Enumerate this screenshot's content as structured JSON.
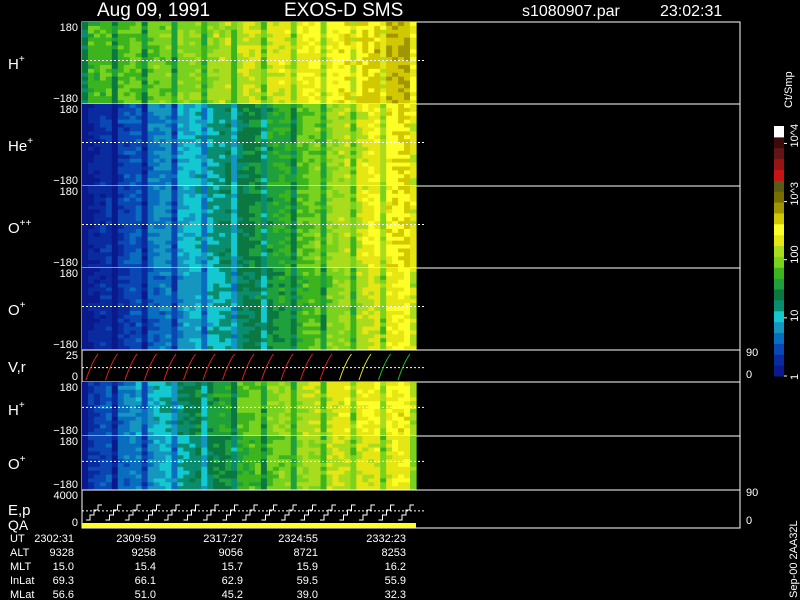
{
  "header": {
    "date": "Aug 09, 1991",
    "instrument": "EXOS-D SMS",
    "file": "s1080907.par",
    "time": "23:02:31"
  },
  "colorbar": {
    "unit": "Ct/Smp",
    "ticks": [
      {
        "label": "1",
        "value": 1
      },
      {
        "label": "10",
        "value": 10
      },
      {
        "label": "100",
        "value": 100
      },
      {
        "label": "10^3",
        "value": 1000
      },
      {
        "label": "10^4",
        "value": 10000
      }
    ],
    "colors": [
      "#0a1a8c",
      "#0a2aa0",
      "#0a46b4",
      "#0a6ec0",
      "#1496c0",
      "#14c8d2",
      "#0a8c6e",
      "#0a7840",
      "#1ea03c",
      "#3cb41e",
      "#78d21e",
      "#aadc1e",
      "#e6e614",
      "#ffff28",
      "#d2c800",
      "#a09600",
      "#786e00",
      "#5a5a14",
      "#c81414",
      "#961414",
      "#641414",
      "#3c0a0a",
      "#ffffff"
    ]
  },
  "panels": [
    {
      "label": "H",
      "sup": "+",
      "ymax": "180",
      "ymin": "−180",
      "type": "spectrogram"
    },
    {
      "label": "He",
      "sup": "+",
      "ymax": "180",
      "ymin": "−180",
      "type": "spectrogram"
    },
    {
      "label": "O",
      "sup": "++",
      "ymax": "180",
      "ymin": "−180",
      "type": "spectrogram"
    },
    {
      "label": "O",
      "sup": "+",
      "ymax": "180",
      "ymin": "−180",
      "type": "spectrogram"
    },
    {
      "label": "V,r",
      "sup": "",
      "ymax": "25",
      "ymin": "0",
      "right_top": "90",
      "right_bottom": "0",
      "type": "line"
    },
    {
      "label": "H",
      "sup": "+",
      "ymax": "180",
      "ymin": "−180",
      "type": "spectrogram"
    },
    {
      "label": "O",
      "sup": "+",
      "ymax": "180",
      "ymin": "−180",
      "type": "spectrogram"
    },
    {
      "label": "E,p",
      "label2": "QA",
      "ymax": "4000",
      "ymin": "0",
      "right_top": "90",
      "right_bottom": "0",
      "type": "line"
    }
  ],
  "footer": {
    "rows": [
      {
        "name": "UT",
        "values": [
          "2302:31",
          "2309:59",
          "2317:27",
          "2324:55",
          "2332:23"
        ]
      },
      {
        "name": "ALT",
        "values": [
          "9328",
          "9258",
          "9056",
          "8721",
          "8253"
        ]
      },
      {
        "name": "MLT",
        "values": [
          "15.0",
          "15.4",
          "15.7",
          "15.9",
          "16.2"
        ]
      },
      {
        "name": "InLat",
        "values": [
          "69.3",
          "66.1",
          "62.9",
          "59.5",
          "55.9"
        ]
      },
      {
        "name": "MLat",
        "values": [
          "56.6",
          "51.0",
          "45.2",
          "39.0",
          "32.3"
        ]
      }
    ],
    "side_label": "Sep-00  2AA32L"
  },
  "chart_data": {
    "type": "heatmap",
    "title": "Aug 09, 1991   EXOS-D SMS",
    "x": [
      "2302:31",
      "2309:59",
      "2317:27",
      "2324:55",
      "2332:23"
    ],
    "x_range_end_fraction": 0.5,
    "series": [
      {
        "name": "H+",
        "ylim": [
          -180,
          180
        ],
        "intensity_trend": [
          0.55,
          0.62,
          0.7,
          0.78,
          0.9
        ]
      },
      {
        "name": "He+",
        "ylim": [
          -180,
          180
        ],
        "intensity_trend": [
          0.05,
          0.25,
          0.45,
          0.65,
          0.85
        ]
      },
      {
        "name": "O++",
        "ylim": [
          -180,
          180
        ],
        "intensity_trend": [
          0.05,
          0.25,
          0.45,
          0.65,
          0.85
        ]
      },
      {
        "name": "O+",
        "ylim": [
          -180,
          180
        ],
        "intensity_trend": [
          0.05,
          0.22,
          0.42,
          0.62,
          0.8
        ]
      },
      {
        "name": "H+",
        "ylim": [
          -180,
          180
        ],
        "intensity_trend": [
          0.1,
          0.35,
          0.6,
          0.72,
          0.8
        ]
      },
      {
        "name": "O+",
        "ylim": [
          -180,
          180
        ],
        "intensity_trend": [
          0.1,
          0.3,
          0.55,
          0.7,
          0.75
        ]
      }
    ]
  }
}
